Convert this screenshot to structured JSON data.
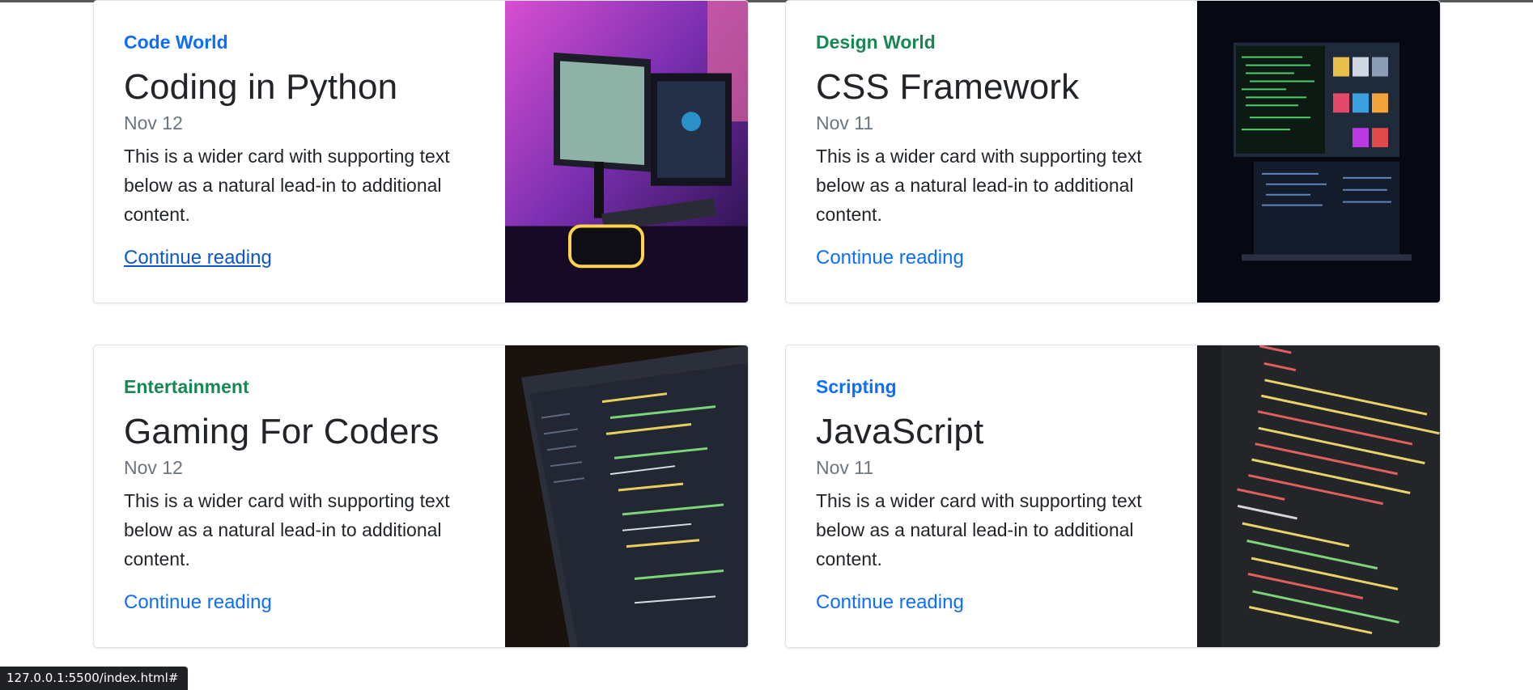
{
  "cards": [
    {
      "category": "Code World",
      "category_color": "#0d6efd",
      "title": "Coding in Python",
      "date": "Nov 12",
      "text": "This is a wider card with supporting text below as a natural lead-in to additional content.",
      "link": "Continue reading",
      "image": "gaming-pc-setup"
    },
    {
      "category": "Design World",
      "category_color": "#198754",
      "title": "CSS Framework",
      "date": "Nov 11",
      "text": "This is a wider card with supporting text below as a natural lead-in to additional content.",
      "link": "Continue reading",
      "image": "dual-monitor-code"
    },
    {
      "category": "Entertainment",
      "category_color": "#198754",
      "title": "Gaming For Coders",
      "date": "Nov 12",
      "text": "This is a wider card with supporting text below as a natural lead-in to additional content.",
      "link": "Continue reading",
      "image": "laptop-code-editor"
    },
    {
      "category": "Scripting",
      "category_color": "#0d6efd",
      "title": "JavaScript",
      "date": "Nov 11",
      "text": "This is a wider card with supporting text below as a natural lead-in to additional content.",
      "link": "Continue reading",
      "image": "html-source-code"
    }
  ],
  "status_bar": {
    "url": "127.0.0.1:5500/index.html#"
  }
}
